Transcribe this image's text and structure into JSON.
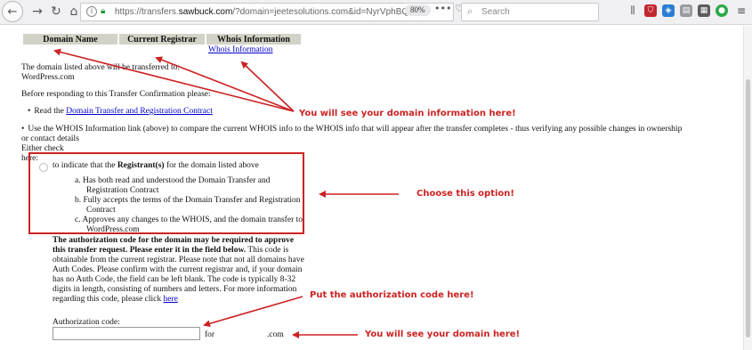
{
  "browser": {
    "url_prefix": "https://transfers.",
    "url_domain": "sawbuck.com",
    "url_rest": "/?domain=jeetesolutions.com&id=NyrVphBQ2W",
    "zoom": "80%",
    "page_actions": "••• ♡ ☆",
    "search_placeholder": "Search"
  },
  "table": {
    "headers": [
      "Domain Name",
      "Current Registrar",
      "Whois Information"
    ],
    "whois_link": "Whois Information"
  },
  "text": {
    "transfer_line1": "The domain listed above will be transferred to:",
    "transfer_line2": "WordPress.com",
    "before_responding": "Before responding to this Transfer Confirmation please:",
    "read_prefix": "Read the ",
    "contract_link": "Domain Transfer and Registration Contract",
    "whois_use_line1": "Use the WHOIS Information link (above) to compare the current WHOIS info to the WHOIS info that will appear after the transfer completes - thus verifying any possible changes in ownership",
    "whois_use_line2": "or contact details",
    "either_check": "Either check",
    "here": "here:"
  },
  "option": {
    "prefix": "to indicate that the ",
    "bold": "Registrant(s)",
    "suffix": " for the domain listed above",
    "items": [
      "a. Has both read and understood the Domain Transfer and Registration Contract",
      "b. Fully accepts the terms of the Domain Transfer and Registration Contract",
      "c. Approves any changes to the WHOIS, and the domain transfer to WordPress.com"
    ]
  },
  "auth": {
    "bold_text": "The authorization code for the domain may be required to approve this transfer request. Please enter it in the field below.",
    "body_text": "This code is obtainable from the current registrar. Please note that not all domains have Auth Codes. Please confirm with the current registrar and, if your domain has no Auth Code, the field can be left blank. The code is typically 8-32 digits in length, consisting of numbers and letters. For more information regarding this code, please click ",
    "here_link": "here",
    "label": "Authorization code:",
    "for_text": "for",
    "tld": ".com"
  },
  "annotations": {
    "domain_info": "You will see your domain information here!",
    "choose_option": "Choose this option!",
    "put_code": "Put the authorization code here!",
    "see_domain": "You will see your domain here!"
  },
  "colors": {
    "annotation_red": "#cc2222",
    "link_blue": "#0000cc",
    "table_header_bg": "#d3d2c6"
  }
}
